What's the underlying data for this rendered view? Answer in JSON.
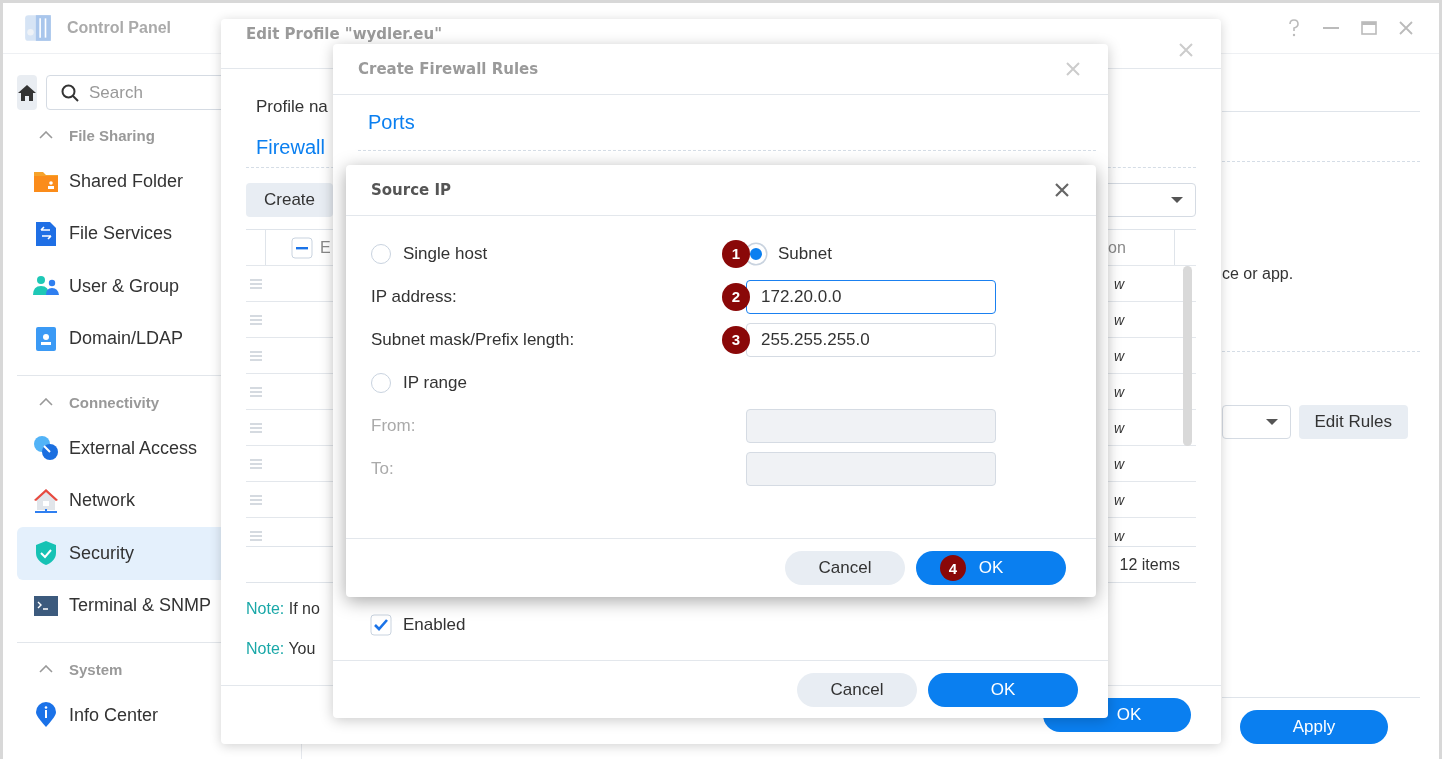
{
  "control_panel": {
    "title": "Control Panel",
    "search": {
      "placeholder": "Search"
    },
    "sections": [
      {
        "title": "File Sharing",
        "expanded": true,
        "items": [
          {
            "label": "Shared Folder",
            "selected": false
          },
          {
            "label": "File Services",
            "selected": false
          },
          {
            "label": "User & Group",
            "selected": false
          },
          {
            "label": "Domain/LDAP",
            "selected": false
          }
        ]
      },
      {
        "title": "Connectivity",
        "expanded": true,
        "items": [
          {
            "label": "External Access",
            "selected": false
          },
          {
            "label": "Network",
            "selected": false
          },
          {
            "label": "Security",
            "selected": true
          },
          {
            "label": "Terminal & SNMP",
            "selected": false
          }
        ]
      },
      {
        "title": "System",
        "expanded": true,
        "items": [
          {
            "label": "Info Center",
            "selected": false
          }
        ]
      }
    ],
    "main": {
      "hint_fragment": "ce or app.",
      "edit_rules_button": "Edit Rules",
      "apply_button": "Apply"
    }
  },
  "edit_profile": {
    "title": "Edit Profile \"wydler.eu\"",
    "profile_label": "Profile na",
    "section": "Firewall",
    "create_button": "Create",
    "select_all_partial": true,
    "header_fragment": "E",
    "column_fragment": "on",
    "rows": [
      {
        "cell": "w"
      },
      {
        "cell": "w"
      },
      {
        "cell": "w"
      },
      {
        "cell": "w"
      },
      {
        "cell": "w"
      },
      {
        "cell": "w"
      },
      {
        "cell": "w"
      },
      {
        "cell": "w"
      }
    ],
    "count": "12 items",
    "notes": [
      {
        "label": "Note:",
        "text": "If no"
      },
      {
        "label": "Note:",
        "text": "You"
      }
    ],
    "ok_button": "OK"
  },
  "firewall_rules": {
    "title": "Create Firewall Rules",
    "section": "Ports",
    "enabled": {
      "label": "Enabled",
      "checked": true
    },
    "cancel_button": "Cancel",
    "ok_button": "OK"
  },
  "source_ip": {
    "title": "Source IP",
    "options": [
      {
        "label": "Single host",
        "selected": false
      },
      {
        "label": "Subnet",
        "selected": true,
        "marker": "1"
      }
    ],
    "fields": [
      {
        "label": "IP address:",
        "value": "172.20.0.0",
        "focused": true,
        "marker": "2"
      },
      {
        "label": "Subnet mask/Prefix length:",
        "value": "255.255.255.0",
        "focused": false,
        "marker": "3"
      }
    ],
    "range_option": {
      "label": "IP range",
      "selected": false
    },
    "range_fields": [
      {
        "label": "From:",
        "disabled": true
      },
      {
        "label": "To:",
        "disabled": true
      }
    ],
    "cancel_button": "Cancel",
    "ok_button": "OK",
    "ok_marker": "4"
  }
}
